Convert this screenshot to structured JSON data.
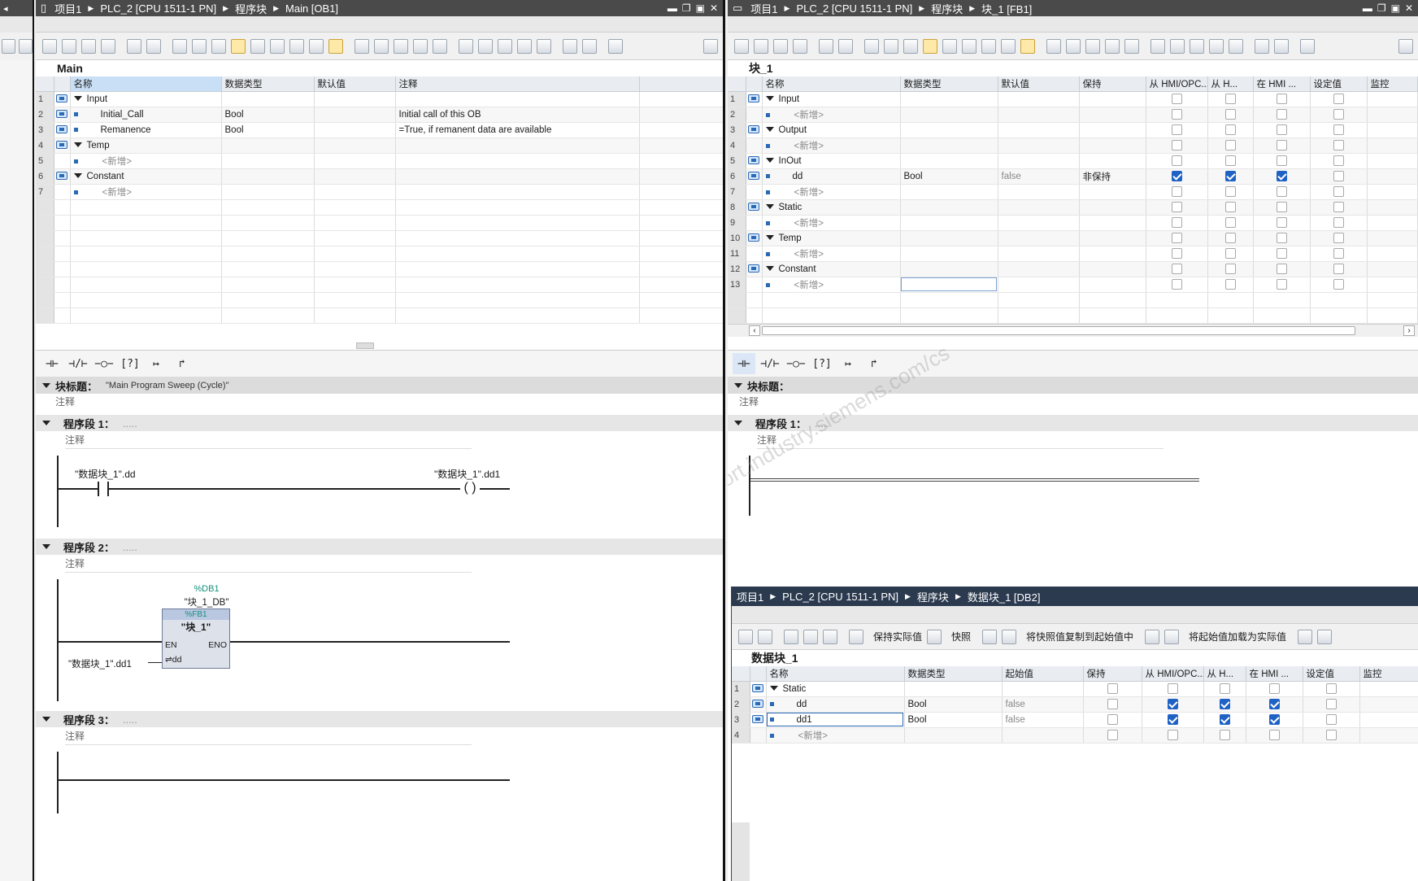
{
  "left_window": {
    "breadcrumb": [
      "项目1",
      "PLC_2 [CPU 1511-1 PN]",
      "程序块",
      "Main [OB1]"
    ],
    "block_name": "Main",
    "columns": [
      "名称",
      "数据类型",
      "默认值",
      "注释"
    ],
    "rows": [
      {
        "n": "1",
        "name": "Input",
        "type": "",
        "default": "",
        "comment": "",
        "kind": "section"
      },
      {
        "n": "2",
        "name": "Initial_Call",
        "type": "Bool",
        "default": "",
        "comment": "Initial call of this OB",
        "kind": "var"
      },
      {
        "n": "3",
        "name": "Remanence",
        "type": "Bool",
        "default": "",
        "comment": "=True, if remanent data are available",
        "kind": "var"
      },
      {
        "n": "4",
        "name": "Temp",
        "type": "",
        "default": "",
        "comment": "",
        "kind": "section"
      },
      {
        "n": "5",
        "name": "<新增>",
        "type": "",
        "default": "",
        "comment": "",
        "kind": "new"
      },
      {
        "n": "6",
        "name": "Constant",
        "type": "",
        "default": "",
        "comment": "",
        "kind": "section"
      },
      {
        "n": "7",
        "name": "<新增>",
        "type": "",
        "default": "",
        "comment": "",
        "kind": "new"
      }
    ],
    "block_title_label": "块标题：",
    "block_title_value": "\"Main Program Sweep (Cycle)\"",
    "comment_label": "注释",
    "networks": [
      {
        "label": "程序段 1：",
        "dots": ".....",
        "contact": "\"数据块_1\".dd",
        "coil": "\"数据块_1\".dd1"
      },
      {
        "label": "程序段 2：",
        "dots": ".....",
        "db": "%DB1",
        "db_name": "\"块_1_DB\"",
        "fb": "%FB1",
        "fb_name": "\"块_1\"",
        "en": "EN",
        "eno": "ENO",
        "input_param": "\"数据块_1\".dd1",
        "pin": "⇌dd"
      },
      {
        "label": "程序段 3：",
        "dots": "....."
      }
    ]
  },
  "right_window": {
    "breadcrumb": [
      "项目1",
      "PLC_2 [CPU 1511-1 PN]",
      "程序块",
      "块_1 [FB1]"
    ],
    "block_name": "块_1",
    "columns": [
      "名称",
      "数据类型",
      "默认值",
      "保持",
      "从 HMI/OPC...",
      "从 H...",
      "在 HMI ...",
      "设定值",
      "监控"
    ],
    "rows": [
      {
        "n": "1",
        "name": "Input",
        "kind": "section",
        "type": "",
        "default": "",
        "retain": "",
        "c1": false,
        "c2": false,
        "c3": false
      },
      {
        "n": "2",
        "name": "<新增>",
        "kind": "new",
        "type": "",
        "default": "",
        "retain": "",
        "c1": false,
        "c2": false,
        "c3": false
      },
      {
        "n": "3",
        "name": "Output",
        "kind": "section",
        "type": "",
        "default": "",
        "retain": "",
        "c1": false,
        "c2": false,
        "c3": false
      },
      {
        "n": "4",
        "name": "<新增>",
        "kind": "new",
        "type": "",
        "default": "",
        "retain": "",
        "c1": false,
        "c2": false,
        "c3": false
      },
      {
        "n": "5",
        "name": "InOut",
        "kind": "section",
        "type": "",
        "default": "",
        "retain": "",
        "c1": false,
        "c2": false,
        "c3": false
      },
      {
        "n": "6",
        "name": "dd",
        "kind": "var",
        "type": "Bool",
        "default": "false",
        "retain": "非保持",
        "c1": true,
        "c2": true,
        "c3": true
      },
      {
        "n": "7",
        "name": "<新增>",
        "kind": "new",
        "type": "",
        "default": "",
        "retain": "",
        "c1": false,
        "c2": false,
        "c3": false
      },
      {
        "n": "8",
        "name": "Static",
        "kind": "section",
        "type": "",
        "default": "",
        "retain": "",
        "c1": false,
        "c2": false,
        "c3": false
      },
      {
        "n": "9",
        "name": "<新增>",
        "kind": "new",
        "type": "",
        "default": "",
        "retain": "",
        "c1": false,
        "c2": false,
        "c3": false
      },
      {
        "n": "10",
        "name": "Temp",
        "kind": "section",
        "type": "",
        "default": "",
        "retain": "",
        "c1": false,
        "c2": false,
        "c3": false
      },
      {
        "n": "11",
        "name": "<新增>",
        "kind": "new",
        "type": "",
        "default": "",
        "retain": "",
        "c1": false,
        "c2": false,
        "c3": false
      },
      {
        "n": "12",
        "name": "Constant",
        "kind": "section",
        "type": "",
        "default": "",
        "retain": "",
        "c1": false,
        "c2": false,
        "c3": false
      },
      {
        "n": "13",
        "name": "<新增>",
        "kind": "new",
        "type": "",
        "default": "",
        "retain": "",
        "c1": false,
        "c2": false,
        "c3": false
      }
    ],
    "block_title_label": "块标题：",
    "comment_label": "注释",
    "network1_label": "程序段 1：",
    "network1_dots": "....."
  },
  "db_window": {
    "breadcrumb": [
      "项目1",
      "PLC_2 [CPU 1511-1 PN]",
      "程序块",
      "数据块_1 [DB2]"
    ],
    "toolbar_labels": [
      "保持实际值",
      "快照",
      "将快照值复制到起始值中",
      "将起始值加载为实际值"
    ],
    "block_name": "数据块_1",
    "columns": [
      "名称",
      "数据类型",
      "起始值",
      "保持",
      "从 HMI/OPC...",
      "从 H...",
      "在 HMI ...",
      "设定值",
      "监控"
    ],
    "rows": [
      {
        "n": "1",
        "name": "Static",
        "kind": "section",
        "type": "",
        "start": "",
        "c1": false,
        "c2": false,
        "c3": false
      },
      {
        "n": "2",
        "name": "dd",
        "kind": "var",
        "type": "Bool",
        "start": "false",
        "c1": true,
        "c2": true,
        "c3": true
      },
      {
        "n": "3",
        "name": "dd1",
        "kind": "var",
        "type": "Bool",
        "start": "false",
        "c1": true,
        "c2": true,
        "c3": true
      },
      {
        "n": "4",
        "name": "<新增>",
        "kind": "new",
        "type": "",
        "start": "",
        "c1": false,
        "c2": false,
        "c3": false
      }
    ]
  },
  "watermark": "西门子工业 support.industry.siemens.com/cs",
  "colors": {
    "titlebar": "#4a4a4a",
    "db_titlebar": "#2b3a4f",
    "checkbox_on": "#1f62c4",
    "network_db": "#16907e"
  }
}
